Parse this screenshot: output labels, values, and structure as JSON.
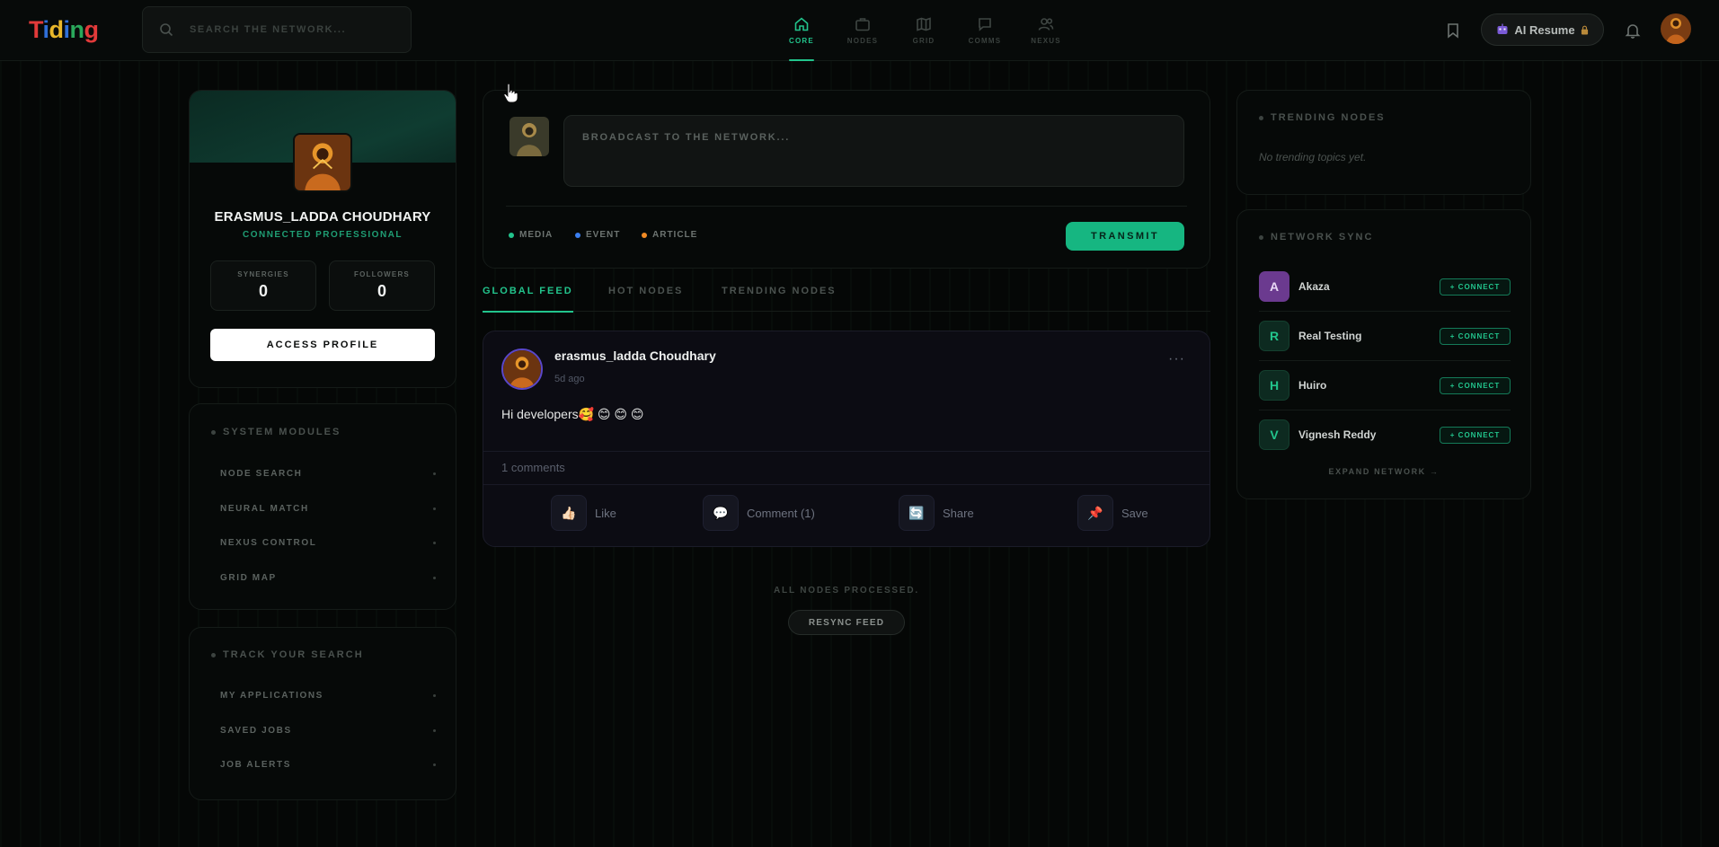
{
  "app": {
    "logo_letters": [
      "T",
      "i",
      "d",
      "i",
      "n",
      "g"
    ],
    "brand_colors": [
      "#e23a3a",
      "#2f6fd8",
      "#e9b72a",
      "#2f6fd8",
      "#2aa85b",
      "#e23a3a"
    ],
    "accent": "#22c48c"
  },
  "search": {
    "placeholder": "SEARCH THE NETWORK..."
  },
  "nav": {
    "items": [
      {
        "label": "CORE",
        "icon": "home-icon",
        "active": true
      },
      {
        "label": "NODES",
        "icon": "briefcase-icon",
        "active": false
      },
      {
        "label": "GRID",
        "icon": "map-icon",
        "active": false
      },
      {
        "label": "COMMS",
        "icon": "chat-icon",
        "active": false
      },
      {
        "label": "NEXUS",
        "icon": "users-icon",
        "active": false
      }
    ]
  },
  "header_actions": {
    "resume_label": "AI Resume",
    "bookmark_icon": "bookmark-icon",
    "bell_icon": "bell-icon"
  },
  "profile": {
    "name": "ERASMUS_LADDA CHOUDHARY",
    "role": "CONNECTED PROFESSIONAL",
    "stats": [
      {
        "label": "SYNERGIES",
        "value": "0"
      },
      {
        "label": "FOLLOWERS",
        "value": "0"
      }
    ],
    "access_button": "ACCESS PROFILE"
  },
  "system_modules": {
    "title": "SYSTEM MODULES",
    "items": [
      "NODE SEARCH",
      "NEURAL MATCH",
      "NEXUS CONTROL",
      "GRID MAP"
    ]
  },
  "track_search": {
    "title": "TRACK YOUR SEARCH",
    "items": [
      "MY APPLICATIONS",
      "SAVED JOBS",
      "JOB ALERTS"
    ]
  },
  "composer": {
    "placeholder": "BROADCAST TO THE NETWORK...",
    "attachments": [
      {
        "label": "MEDIA",
        "color": "#22c48c"
      },
      {
        "label": "EVENT",
        "color": "#3b7ff0"
      },
      {
        "label": "ARTICLE",
        "color": "#f08a24"
      }
    ],
    "submit_label": "TRANSMIT"
  },
  "feed_tabs": [
    {
      "label": "GLOBAL FEED",
      "active": true
    },
    {
      "label": "HOT NODES",
      "active": false
    },
    {
      "label": "TRENDING NODES",
      "active": false
    }
  ],
  "post": {
    "author": "erasmus_ladda Choudhary",
    "time": "5d ago",
    "body": "Hi developers🥰 😊 😊 😊",
    "comments": "1 comments",
    "actions": [
      {
        "label": "Like",
        "icon": "👍🏻"
      },
      {
        "label": "Comment (1)",
        "icon": "💬"
      },
      {
        "label": "Share",
        "icon": "🔄"
      },
      {
        "label": "Save",
        "icon": "📌"
      }
    ],
    "menu": "···"
  },
  "feed_end": {
    "text": "ALL NODES PROCESSED.",
    "resync_label": "RESYNC FEED"
  },
  "trending": {
    "title": "TRENDING NODES",
    "empty_text": "No trending topics yet."
  },
  "network_sync": {
    "title": "NETWORK SYNC",
    "people": [
      {
        "initial": "A",
        "name": "Akaza",
        "bg": "#6b3a8f",
        "fg": "#e9d8f5"
      },
      {
        "initial": "R",
        "name": "Real Testing",
        "bg": "#0d2a20",
        "fg": "#22c48c"
      },
      {
        "initial": "H",
        "name": "Huiro",
        "bg": "#0d2a20",
        "fg": "#22c48c"
      },
      {
        "initial": "V",
        "name": "Vignesh Reddy",
        "bg": "#0d2a20",
        "fg": "#22c48c"
      }
    ],
    "connect_label": "+ CONNECT",
    "expand_label": "EXPAND NETWORK →"
  }
}
